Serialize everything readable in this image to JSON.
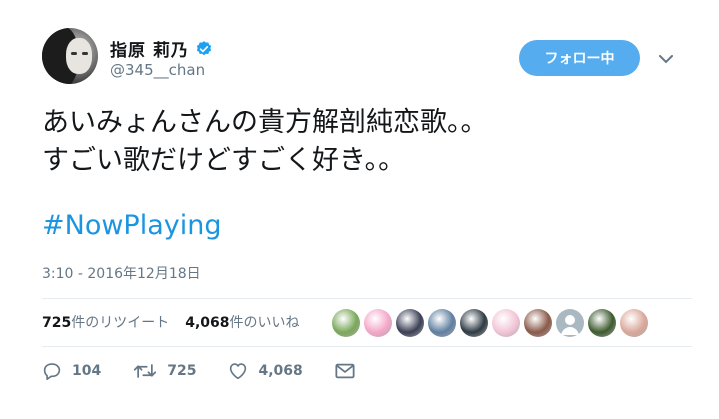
{
  "user": {
    "display_name": "指原 莉乃",
    "handle": "@345__chan",
    "verified": true
  },
  "follow_button": {
    "label": "フォロー中"
  },
  "tweet": {
    "lines": [
      "あいみょんさんの貴方解剖純恋歌。。",
      "すごい歌だけどすごく好き。。"
    ],
    "hashtag": "#NowPlaying",
    "timestamp": "3:10 - 2016年12月18日"
  },
  "stats": {
    "retweet_count": "725",
    "retweet_suffix": "件のリツイート",
    "like_count": "4,068",
    "like_suffix": "件のいいね"
  },
  "liker_avatars": [
    {
      "icon": "avatar-landscape",
      "color": "#7aa85a"
    },
    {
      "icon": "avatar-anime-pink",
      "color": "#f4a6c8"
    },
    {
      "icon": "avatar-person-dark",
      "color": "#3a3f55"
    },
    {
      "icon": "avatar-sea",
      "color": "#5f7fa0"
    },
    {
      "icon": "avatar-dark-scene",
      "color": "#2e3a44"
    },
    {
      "icon": "avatar-pink-pattern",
      "color": "#f2c4d6"
    },
    {
      "icon": "avatar-girl",
      "color": "#8a5a4a"
    },
    {
      "icon": "avatar-default-gray",
      "color": "#aab8c2"
    },
    {
      "icon": "avatar-green-field",
      "color": "#3d5a2e"
    },
    {
      "icon": "avatar-woman",
      "color": "#d9a89a"
    }
  ],
  "actions": {
    "reply_count": "104",
    "retweet_count": "725",
    "like_count": "4,068"
  },
  "colors": {
    "accent": "#55acee",
    "link": "#1b95e0",
    "secondary_text": "#657786"
  }
}
